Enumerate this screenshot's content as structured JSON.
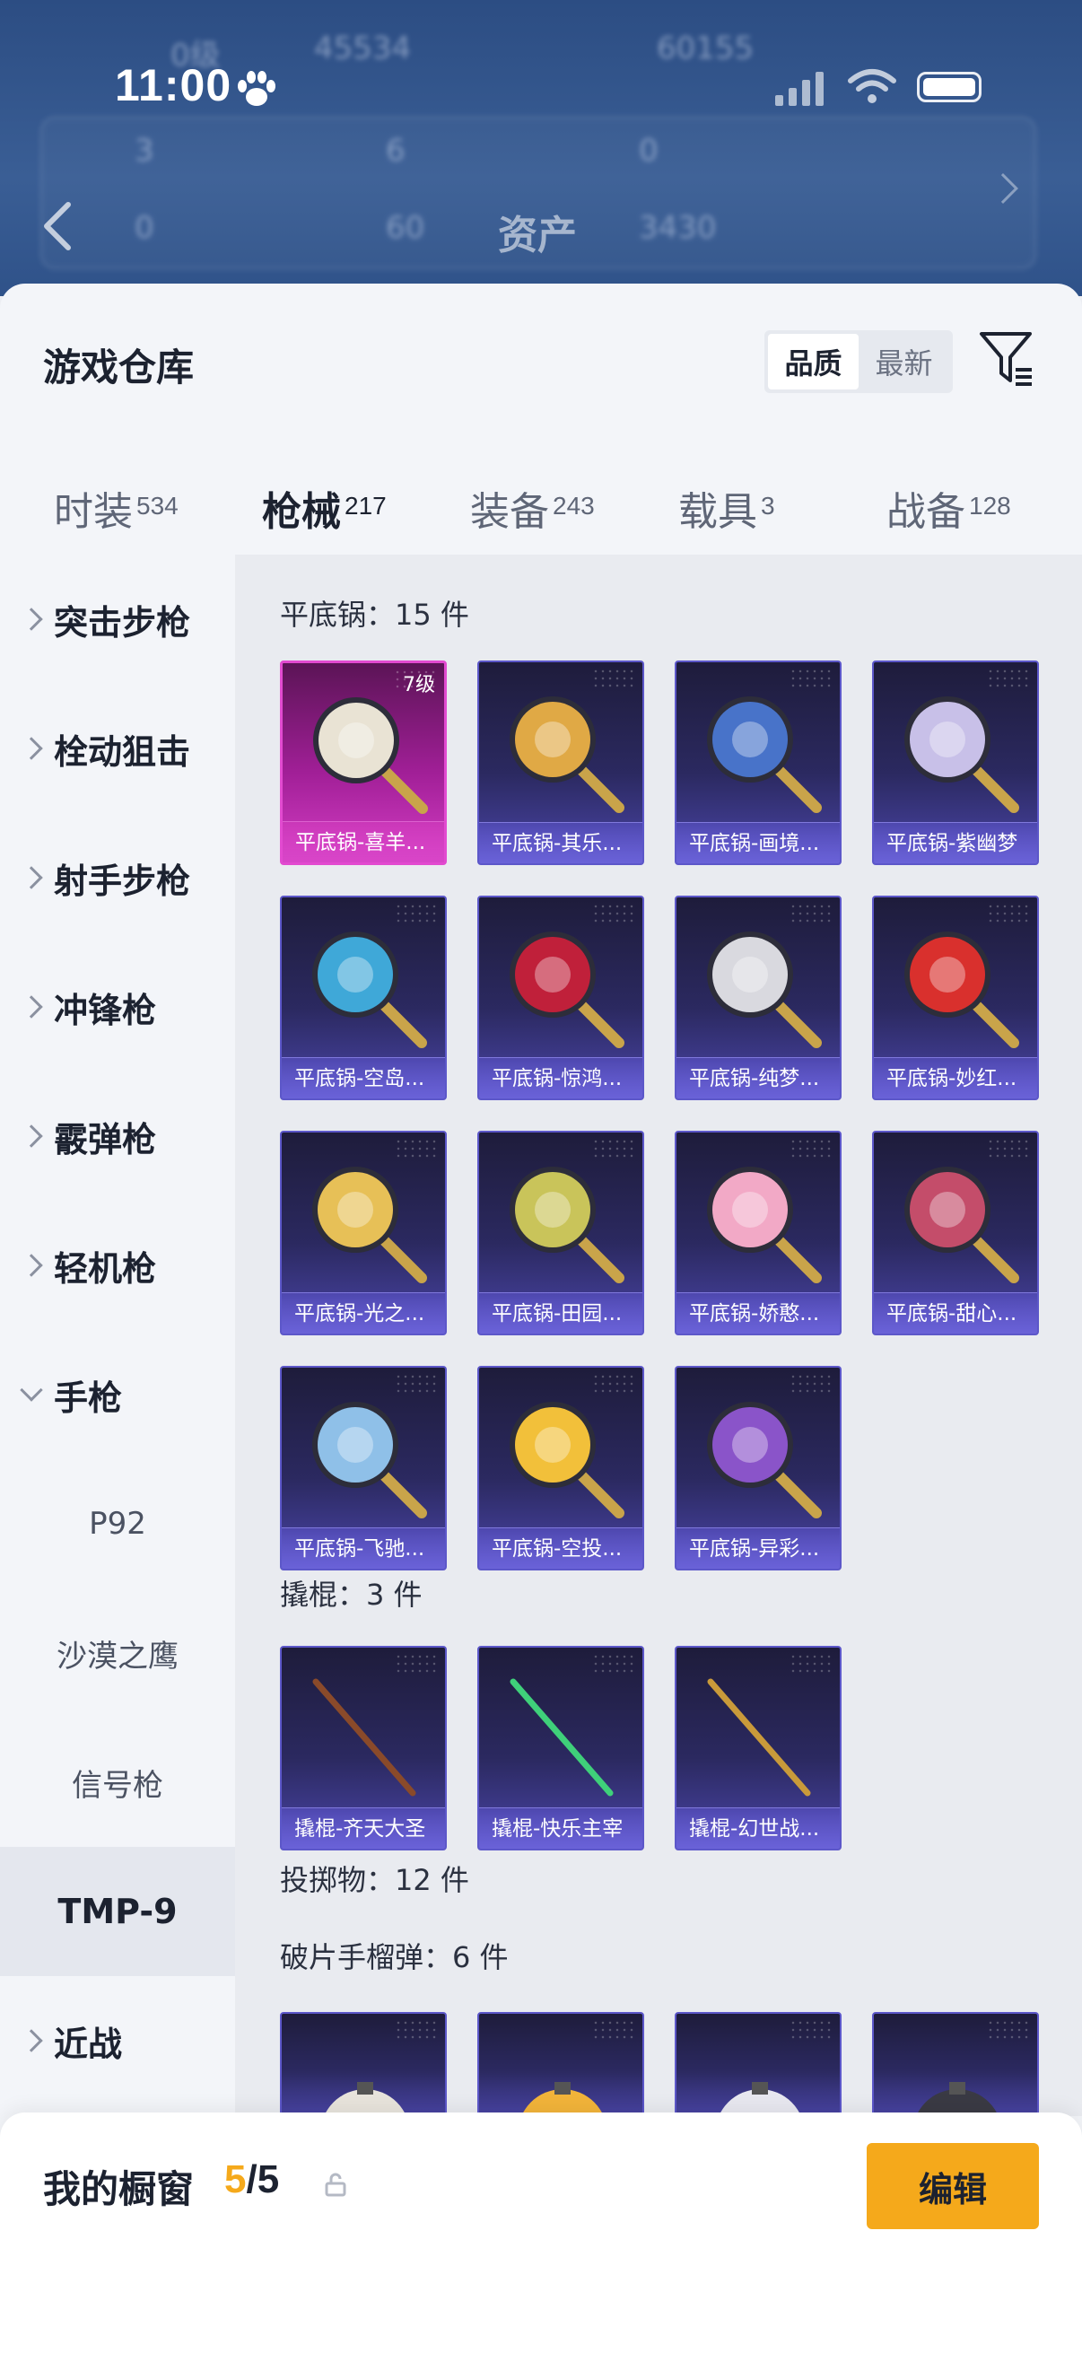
{
  "status": {
    "time": "11:00"
  },
  "background": {
    "title": "资产",
    "faded_stats": [
      "0级",
      "45534",
      "60155",
      "3",
      "6",
      "0",
      "0",
      "60",
      "3430"
    ]
  },
  "header": {
    "title": "游戏仓库",
    "sort_options": [
      "品质",
      "最新"
    ],
    "active_sort": "品质"
  },
  "tabs": [
    {
      "label": "时装",
      "count": "534"
    },
    {
      "label": "枪械",
      "count": "217"
    },
    {
      "label": "装备",
      "count": "243"
    },
    {
      "label": "载具",
      "count": "3"
    },
    {
      "label": "战备",
      "count": "128"
    }
  ],
  "active_tab": "枪械",
  "sidebar": {
    "items": [
      {
        "label": "突击步枪"
      },
      {
        "label": "栓动狙击"
      },
      {
        "label": "射手步枪"
      },
      {
        "label": "冲锋枪"
      },
      {
        "label": "霰弹枪"
      },
      {
        "label": "轻机枪"
      },
      {
        "label": "手枪"
      }
    ],
    "sub_items": [
      {
        "label": "P92"
      },
      {
        "label": "沙漠之鹰"
      },
      {
        "label": "信号枪"
      },
      {
        "label": "TMP-9"
      }
    ],
    "selected": "TMP-9",
    "last_item": {
      "label": "近战"
    }
  },
  "sections": [
    {
      "title": "平底锅：15 件",
      "items": [
        {
          "name": "平底锅-喜羊...",
          "level": "7级",
          "rarity": "pink"
        },
        {
          "name": "平底锅-其乐...",
          "rarity": "purple"
        },
        {
          "name": "平底锅-画境...",
          "rarity": "purple"
        },
        {
          "name": "平底锅-紫幽梦",
          "rarity": "purple"
        },
        {
          "name": "平底锅-空岛...",
          "rarity": "purple"
        },
        {
          "name": "平底锅-惊鸿...",
          "rarity": "purple"
        },
        {
          "name": "平底锅-纯梦...",
          "rarity": "purple"
        },
        {
          "name": "平底锅-妙红...",
          "rarity": "purple"
        },
        {
          "name": "平底锅-光之...",
          "rarity": "purple"
        },
        {
          "name": "平底锅-田园...",
          "rarity": "purple"
        },
        {
          "name": "平底锅-娇憨...",
          "rarity": "purple"
        },
        {
          "name": "平底锅-甜心...",
          "rarity": "purple"
        },
        {
          "name": "平底锅-飞驰...",
          "rarity": "purple"
        },
        {
          "name": "平底锅-空投...",
          "rarity": "purple"
        },
        {
          "name": "平底锅-异彩...",
          "rarity": "purple"
        }
      ]
    },
    {
      "title": "撬棍：3 件",
      "items": [
        {
          "name": "撬棍-齐天大圣",
          "rarity": "purple"
        },
        {
          "name": "撬棍-快乐主宰",
          "rarity": "purple"
        },
        {
          "name": "撬棍-幻世战...",
          "rarity": "purple"
        }
      ]
    },
    {
      "title": "投掷物：12 件",
      "items": []
    },
    {
      "title": "破片手榴弹：6 件",
      "items": [
        {},
        {},
        {},
        {}
      ]
    }
  ],
  "showcase": {
    "label": "我的橱窗",
    "current": "5",
    "total": "/5",
    "edit_label": "编辑"
  },
  "colors": {
    "accent": "#f5a91b",
    "rarity_purple": "#5c57c9",
    "rarity_pink": "#e24ad0"
  }
}
